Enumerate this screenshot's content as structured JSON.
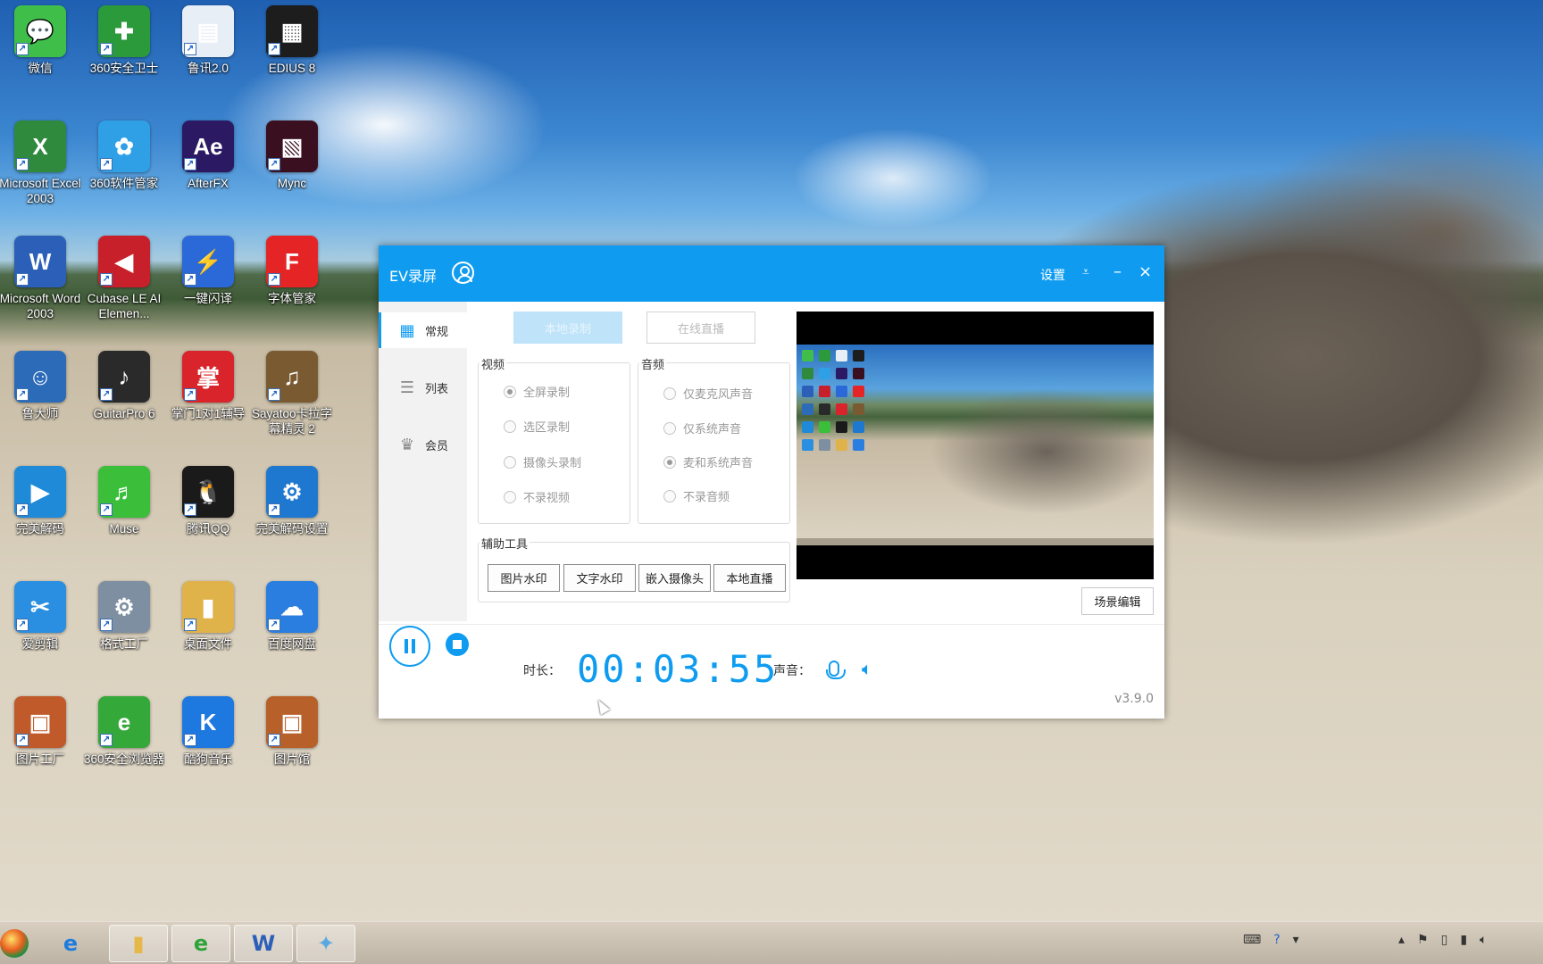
{
  "desktop": {
    "icons": [
      {
        "label": "微信",
        "glyph": "💬",
        "color": "#3fbf4a"
      },
      {
        "label": "360安全卫士",
        "glyph": "✚",
        "color": "#2b9a3a"
      },
      {
        "label": "鲁讯2.0",
        "glyph": "▤",
        "color": "#e8eef6"
      },
      {
        "label": "EDIUS 8",
        "glyph": "▦",
        "color": "#1d1d1d"
      },
      {
        "label": "Microsoft Excel 2003",
        "glyph": "X",
        "color": "#2f8a3e"
      },
      {
        "label": "360软件管家",
        "glyph": "✿",
        "color": "#2fa0e6"
      },
      {
        "label": "AfterFX",
        "glyph": "Ae",
        "color": "#2b1a63"
      },
      {
        "label": "Mync",
        "glyph": "▧",
        "color": "#3a1020"
      },
      {
        "label": "Microsoft Word 2003",
        "glyph": "W",
        "color": "#2b5fb8"
      },
      {
        "label": "Cubase LE AI Elemen...",
        "glyph": "◀",
        "color": "#c8202a"
      },
      {
        "label": "一键闪译",
        "glyph": "⚡",
        "color": "#2b68d8"
      },
      {
        "label": "字体管家",
        "glyph": "F",
        "color": "#e52525"
      },
      {
        "label": "鲁大师",
        "glyph": "☺",
        "color": "#2c6bb8"
      },
      {
        "label": "GuitarPro 6",
        "glyph": "♪",
        "color": "#2a2a2a"
      },
      {
        "label": "掌门1对1辅导",
        "glyph": "掌",
        "color": "#d8242a"
      },
      {
        "label": "Sayatoo卡拉字幕精灵 2",
        "glyph": "♫",
        "color": "#7a5a30"
      },
      {
        "label": "完美解码",
        "glyph": "▶",
        "color": "#1f8ad8"
      },
      {
        "label": "Muse",
        "glyph": "♬",
        "color": "#3bbf3b"
      },
      {
        "label": "腾讯QQ",
        "glyph": "🐧",
        "color": "#1a1a1a"
      },
      {
        "label": "完美解码设置",
        "glyph": "⚙",
        "color": "#1f78d0"
      },
      {
        "label": "爱剪辑",
        "glyph": "✂",
        "color": "#2a8fe0"
      },
      {
        "label": "格式工厂",
        "glyph": "⚙",
        "color": "#7d8fa0"
      },
      {
        "label": "桌面文件",
        "glyph": "▮",
        "color": "#e0b24a"
      },
      {
        "label": "百度网盘",
        "glyph": "☁",
        "color": "#2a7ee0"
      },
      {
        "label": "图片工厂",
        "glyph": "▣",
        "color": "#c05a2a"
      },
      {
        "label": "360安全浏览器",
        "glyph": "e",
        "color": "#35a83a"
      },
      {
        "label": "酷狗音乐",
        "glyph": "K",
        "color": "#1d78e0"
      },
      {
        "label": "图片馆",
        "glyph": "▣",
        "color": "#b8602a"
      }
    ]
  },
  "taskbar": {
    "items": [
      {
        "name": "ie",
        "glyph": "e",
        "color": "#1d7ce0"
      },
      {
        "name": "explorer",
        "glyph": "▮",
        "color": "#e6b84a"
      },
      {
        "name": "360browser",
        "glyph": "e",
        "color": "#2da33a"
      },
      {
        "name": "word",
        "glyph": "W",
        "color": "#2b5fb8"
      },
      {
        "name": "ev-recorder",
        "glyph": "✦",
        "color": "#5aa8e0"
      }
    ]
  },
  "window": {
    "title": "EV录屏",
    "settings_label": "设置",
    "sidebar": [
      {
        "label": "常规",
        "icon": "grid-icon",
        "glyph": "▦"
      },
      {
        "label": "列表",
        "icon": "list-icon",
        "glyph": "☰"
      },
      {
        "label": "会员",
        "icon": "crown-icon",
        "glyph": "♛"
      }
    ],
    "modes": {
      "local": "本地录制",
      "live": "在线直播"
    },
    "video": {
      "title": "视频",
      "options": [
        "全屏录制",
        "选区录制",
        "摄像头录制",
        "不录视频"
      ],
      "selected": 0
    },
    "audio": {
      "title": "音频",
      "options": [
        "仅麦克风声音",
        "仅系统声音",
        "麦和系统声音",
        "不录音频"
      ],
      "selected": 2
    },
    "tools": {
      "title": "辅助工具",
      "buttons": [
        "图片水印",
        "文字水印",
        "嵌入摄像头",
        "本地直播"
      ]
    },
    "scene_edit_label": "场景编辑",
    "duration_label": "时长：",
    "timer": "00:03:55",
    "sound_label": "声音：",
    "version": "v3.9.0",
    "accent_color": "#0f9cf0"
  }
}
